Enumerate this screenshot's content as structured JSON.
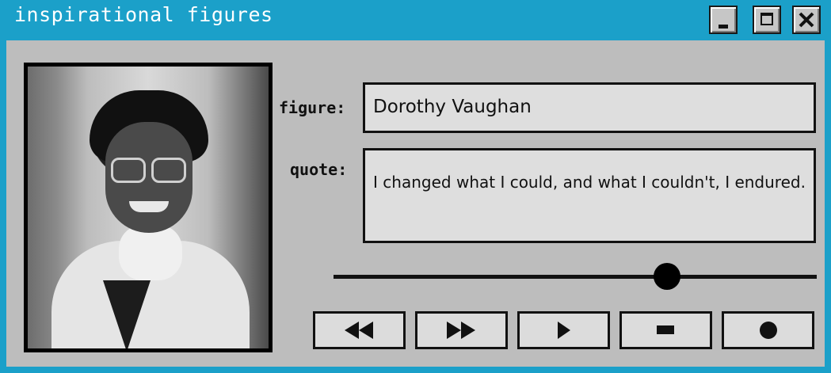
{
  "window": {
    "title": "inspirational figures"
  },
  "labels": {
    "figure": "figure:",
    "quote": "quote:"
  },
  "figure": {
    "name": "Dorothy Vaughan",
    "quote": "I changed what I could, and what I couldn't, I endured."
  },
  "seek": {
    "progress": 0.69
  },
  "controls": [
    {
      "icon": "rewind-icon"
    },
    {
      "icon": "fast-forward-icon"
    },
    {
      "icon": "play-icon"
    },
    {
      "icon": "stop-icon"
    },
    {
      "icon": "record-icon"
    }
  ],
  "colors": {
    "titlebar": "#1ba0c9",
    "panel": "#bdbdbd",
    "field": "#dedede"
  }
}
